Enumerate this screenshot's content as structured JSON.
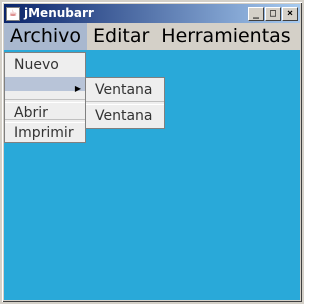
{
  "window": {
    "title": "jMenubarr",
    "controls": {
      "minimize": "_",
      "maximize": "□",
      "close": "×"
    }
  },
  "menubar": {
    "items": [
      "Archivo",
      "Editar",
      "Herramientas"
    ]
  },
  "archivo_menu": {
    "items": [
      "Nuevo",
      "",
      "Abrir",
      "Imprimir"
    ]
  },
  "submenu": {
    "items": [
      "Ventana",
      "Ventana"
    ]
  },
  "colors": {
    "content_background": "#29a9d9",
    "active_menu": "#a9b8cf"
  }
}
